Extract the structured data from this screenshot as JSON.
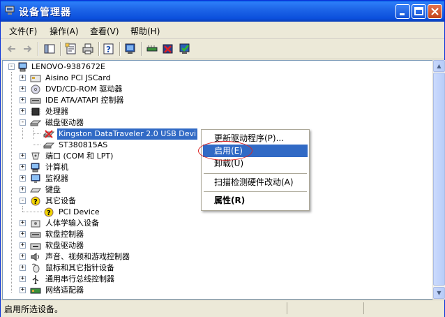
{
  "window": {
    "title": "设备管理器"
  },
  "menu": [
    {
      "label": "文件(F)"
    },
    {
      "label": "操作(A)"
    },
    {
      "label": "查看(V)"
    },
    {
      "label": "帮助(H)"
    }
  ],
  "tree": {
    "root": "LENOVO-9387672E",
    "items": [
      {
        "label": "Aisino PCI JSCard",
        "icon": "smartcard-icon"
      },
      {
        "label": "DVD/CD-ROM 驱动器",
        "icon": "cdrom-icon"
      },
      {
        "label": "IDE ATA/ATAPI 控制器",
        "icon": "ide-controller-icon"
      },
      {
        "label": "处理器",
        "icon": "processor-icon"
      },
      {
        "label": "磁盘驱动器",
        "icon": "disk-drive-icon",
        "expanded": true,
        "children": [
          {
            "label": "Kingston DataTraveler 2.0 USB Devi",
            "icon": "disabled-usb-disk-icon",
            "selected": true
          },
          {
            "label": "ST380815AS",
            "icon": "hard-disk-icon"
          }
        ]
      },
      {
        "label": "端口 (COM 和 LPT)",
        "icon": "port-icon"
      },
      {
        "label": "计算机",
        "icon": "computer-icon"
      },
      {
        "label": "监视器",
        "icon": "monitor-icon"
      },
      {
        "label": "键盘",
        "icon": "keyboard-icon"
      },
      {
        "label": "其它设备",
        "icon": "unknown-device-icon",
        "expanded": true,
        "children": [
          {
            "label": "PCI Device",
            "icon": "unknown-device-icon"
          }
        ]
      },
      {
        "label": "人体学输入设备",
        "icon": "hid-icon"
      },
      {
        "label": "软盘控制器",
        "icon": "floppy-controller-icon"
      },
      {
        "label": "软盘驱动器",
        "icon": "floppy-drive-icon"
      },
      {
        "label": "声音、视频和游戏控制器",
        "icon": "sound-icon"
      },
      {
        "label": "鼠标和其它指针设备",
        "icon": "mouse-icon"
      },
      {
        "label": "通用串行总线控制器",
        "icon": "usb-icon"
      },
      {
        "label": "网络适配器",
        "icon": "network-adapter-icon"
      }
    ]
  },
  "context_menu": {
    "items": [
      {
        "label": "更新驱动程序(P)..."
      },
      {
        "label": "启用(E)",
        "highlighted": true
      },
      {
        "label": "卸载(U)"
      },
      {
        "label": "扫描检测硬件改动(A)"
      },
      {
        "label": "属性(R)",
        "bold": true
      }
    ]
  },
  "status": {
    "text": "启用所选设备。"
  },
  "colors": {
    "title_bar": "#0A5FE5",
    "selection": "#316AC5",
    "annotation": "#DD2222"
  }
}
